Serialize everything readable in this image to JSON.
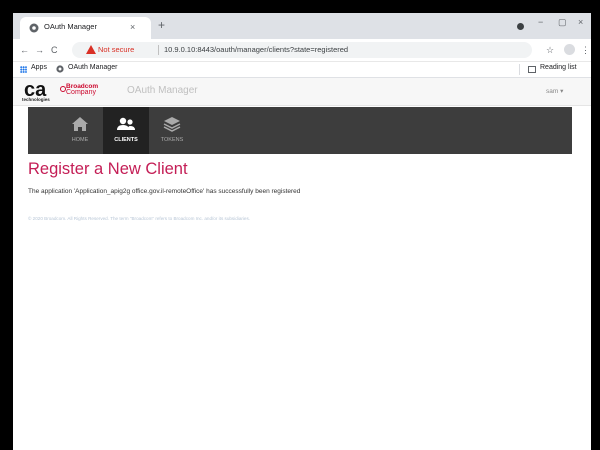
{
  "browser": {
    "tab_title": "OAuth Manager",
    "tab_close": "×",
    "new_tab": "+",
    "window_minimize": "−",
    "window_maximize": "▢",
    "window_close": "×",
    "security_label": "Not secure",
    "url": "10.9.0.10:8443/oauth/manager/clients?state=registered",
    "bookmarks": [
      {
        "label": "Apps"
      },
      {
        "label": "OAuth Manager"
      }
    ],
    "reading_list": "Reading list"
  },
  "header": {
    "ca_text": "ca",
    "ca_sub": "technologies",
    "broadcom_name": "Broadcom",
    "broadcom_company": "Company",
    "app_title": "OAuth Manager",
    "user": "sam ▾"
  },
  "nav": {
    "items": [
      {
        "label": "HOME",
        "icon": "home-icon",
        "active": false
      },
      {
        "label": "CLIENTS",
        "icon": "users-icon",
        "active": true
      },
      {
        "label": "TOKENS",
        "icon": "layers-icon",
        "active": false
      }
    ]
  },
  "main": {
    "title": "Register a New Client",
    "message": "The application 'Application_apig2g office.gov.il-remoteOffice' has successfully been registered"
  },
  "footer": {
    "text": "© 2020 Broadcom. All Rights Reserved. The term \"Broadcom\" refers to Broadcom Inc. and/or its subsidiaries."
  },
  "colors": {
    "accent": "#c41e56",
    "nav_bg": "#3d3d3d",
    "nav_active": "#222222",
    "warning": "#d93025",
    "broadcom_red": "#cc092f"
  }
}
